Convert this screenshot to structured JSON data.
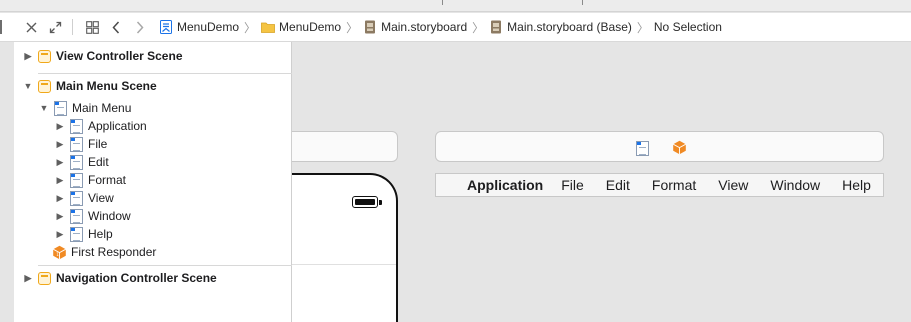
{
  "breadcrumbs": [
    {
      "label": "MenuDemo",
      "icon": "project-icon"
    },
    {
      "label": "MenuDemo",
      "icon": "folder-icon"
    },
    {
      "label": "Main.storyboard",
      "icon": "storyboard-icon"
    },
    {
      "label": "Main.storyboard (Base)",
      "icon": "storyboard-icon"
    },
    {
      "label": "No Selection",
      "icon": ""
    }
  ],
  "outline": {
    "view_controller_scene": "View Controller Scene",
    "main_menu_scene": "Main Menu Scene",
    "main_menu": "Main Menu",
    "menu_items": [
      "Application",
      "File",
      "Edit",
      "Format",
      "View",
      "Window",
      "Help"
    ],
    "first_responder": "First Responder",
    "navigation_controller_scene": "Navigation Controller Scene"
  },
  "canvas": {
    "menubar_items": [
      "Application",
      "File",
      "Edit",
      "Format",
      "View",
      "Window",
      "Help"
    ]
  },
  "colors": {
    "scene_icon": "#f0a81a",
    "responder_icon": "#f08a24",
    "menu_icon_accent": "#1b73e8",
    "project_icon": "#1b73e8",
    "folder_icon": "#f5c443",
    "storyboard_icon": "#8c7a62"
  }
}
